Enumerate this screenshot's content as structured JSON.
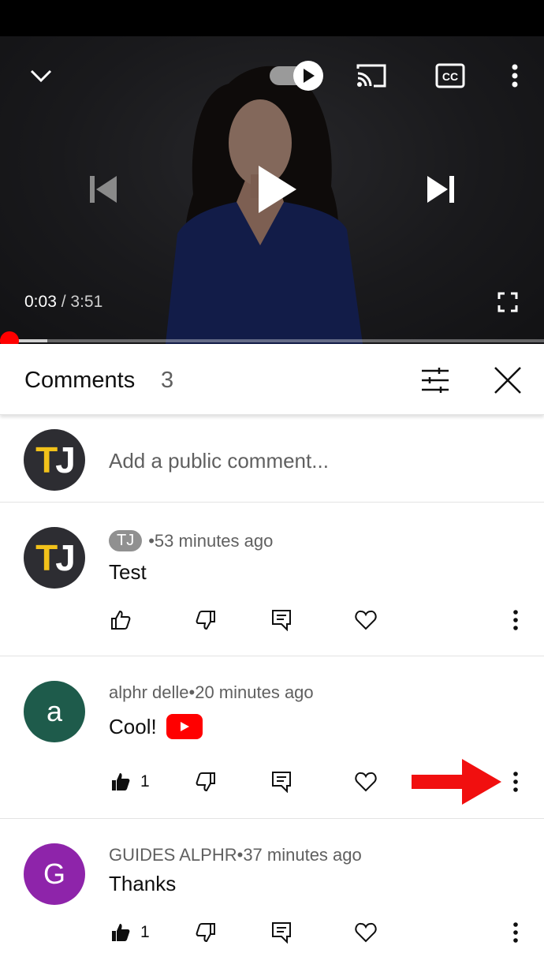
{
  "player": {
    "current_time": "0:03",
    "separator": " / ",
    "duration": "3:51",
    "progress_fraction": 0.013,
    "icons": {
      "minimize": "chevron-down-icon",
      "autoplay": "autoplay-toggle-icon",
      "cast": "cast-icon",
      "captions": "cc-icon",
      "more": "more-vert-icon",
      "previous": "skip-previous-icon",
      "play": "play-icon",
      "next": "skip-next-icon",
      "fullscreen": "fullscreen-icon"
    }
  },
  "comments_panel": {
    "title": "Comments",
    "count": "3",
    "add_comment_placeholder": "Add a public comment...",
    "comments": [
      {
        "author": "TJ",
        "time": "53 minutes ago",
        "text": "Test",
        "likes": ""
      },
      {
        "author": "alphr delle",
        "time": "20 minutes ago",
        "text": "Cool!",
        "likes": "1",
        "avatar_letter": "a"
      },
      {
        "author": "GUIDES ALPHR",
        "time": "37 minutes ago",
        "text": "Thanks",
        "likes": "1",
        "avatar_letter": "G"
      }
    ],
    "meta_separator": " • "
  },
  "colors": {
    "accent_red": "#ff0000",
    "avatar_green": "#1e5b4b",
    "avatar_purple": "#8e24aa",
    "tj_yellow": "#f2c21a"
  }
}
